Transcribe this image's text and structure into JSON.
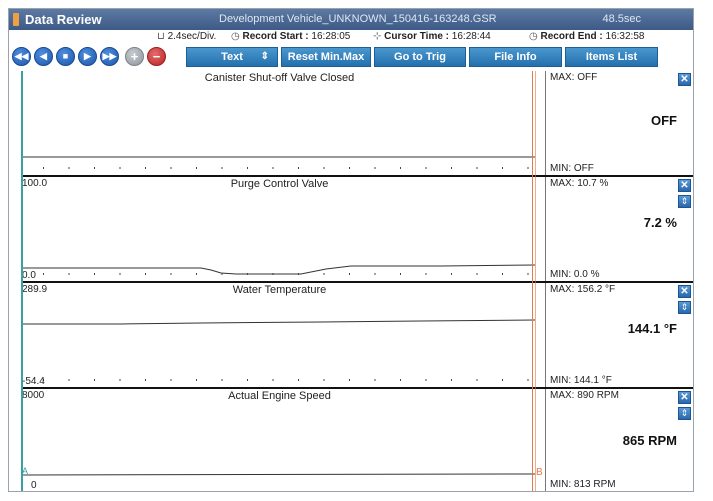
{
  "window": {
    "title": "Data Review",
    "file_name": "Development Vehicle_UNKNOWN_150416-163248.GSR",
    "elapsed": "48.5sec"
  },
  "info": {
    "time_div": "2.4sec/Div.",
    "record_start_label": "Record Start :",
    "record_start": "16:28:05",
    "cursor_time_label": "Cursor Time :",
    "cursor_time": "16:28:44",
    "record_end_label": "Record End :",
    "record_end": "16:32:58"
  },
  "toolbar": {
    "nav_icons": [
      "rewind-icon",
      "step-back-icon",
      "stop-icon",
      "play-icon",
      "fast-forward-icon",
      "zoom-in-icon",
      "zoom-out-icon"
    ],
    "text_button": "Text",
    "reset_button": "Reset Min.Max",
    "trig_button": "Go to Trig",
    "file_info_button": "File Info",
    "items_list_button": "Items List"
  },
  "markers": {
    "a": "A",
    "b": "B"
  },
  "panels": [
    {
      "title": "Canister Shut-off Valve Closed",
      "scale_top": "",
      "scale_bottom": "",
      "max": "MAX: OFF",
      "min": "MIN: OFF",
      "current": "OFF",
      "show_scroll": false
    },
    {
      "title": "Purge Control Valve",
      "scale_top": "100.0",
      "scale_bottom": "0.0",
      "max": "MAX: 10.7 %",
      "min": "MIN:   0.0 %",
      "current": "7.2 %",
      "show_scroll": true
    },
    {
      "title": "Water Temperature",
      "scale_top": "289.9",
      "scale_bottom": "-54.4",
      "max": "MAX: 156.2 °F",
      "min": "MIN: 144.1 °F",
      "current": "144.1 °F",
      "show_scroll": true
    },
    {
      "title": "Actual Engine Speed",
      "scale_top": "8000",
      "scale_bottom": "0",
      "max": "MAX:   890 RPM",
      "min": "MIN:   813 RPM",
      "current": "865 RPM",
      "show_scroll": true
    }
  ]
}
